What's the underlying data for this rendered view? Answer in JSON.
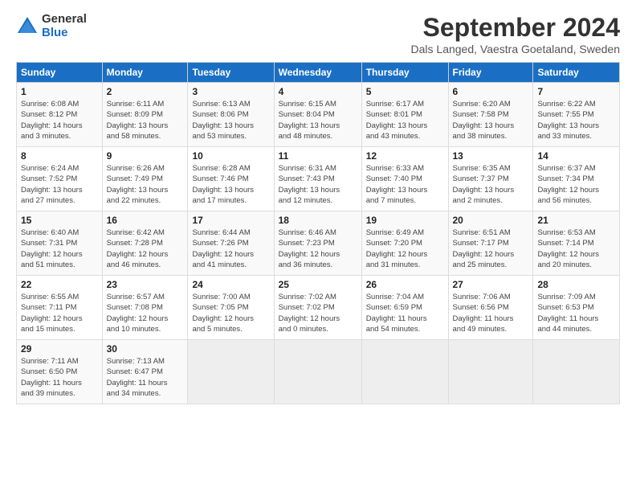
{
  "header": {
    "logo_general": "General",
    "logo_blue": "Blue",
    "month_title": "September 2024",
    "subtitle": "Dals Langed, Vaestra Goetaland, Sweden"
  },
  "days_of_week": [
    "Sunday",
    "Monday",
    "Tuesday",
    "Wednesday",
    "Thursday",
    "Friday",
    "Saturday"
  ],
  "weeks": [
    [
      {
        "day": "1",
        "info": "Sunrise: 6:08 AM\nSunset: 8:12 PM\nDaylight: 14 hours\nand 3 minutes."
      },
      {
        "day": "2",
        "info": "Sunrise: 6:11 AM\nSunset: 8:09 PM\nDaylight: 13 hours\nand 58 minutes."
      },
      {
        "day": "3",
        "info": "Sunrise: 6:13 AM\nSunset: 8:06 PM\nDaylight: 13 hours\nand 53 minutes."
      },
      {
        "day": "4",
        "info": "Sunrise: 6:15 AM\nSunset: 8:04 PM\nDaylight: 13 hours\nand 48 minutes."
      },
      {
        "day": "5",
        "info": "Sunrise: 6:17 AM\nSunset: 8:01 PM\nDaylight: 13 hours\nand 43 minutes."
      },
      {
        "day": "6",
        "info": "Sunrise: 6:20 AM\nSunset: 7:58 PM\nDaylight: 13 hours\nand 38 minutes."
      },
      {
        "day": "7",
        "info": "Sunrise: 6:22 AM\nSunset: 7:55 PM\nDaylight: 13 hours\nand 33 minutes."
      }
    ],
    [
      {
        "day": "8",
        "info": "Sunrise: 6:24 AM\nSunset: 7:52 PM\nDaylight: 13 hours\nand 27 minutes."
      },
      {
        "day": "9",
        "info": "Sunrise: 6:26 AM\nSunset: 7:49 PM\nDaylight: 13 hours\nand 22 minutes."
      },
      {
        "day": "10",
        "info": "Sunrise: 6:28 AM\nSunset: 7:46 PM\nDaylight: 13 hours\nand 17 minutes."
      },
      {
        "day": "11",
        "info": "Sunrise: 6:31 AM\nSunset: 7:43 PM\nDaylight: 13 hours\nand 12 minutes."
      },
      {
        "day": "12",
        "info": "Sunrise: 6:33 AM\nSunset: 7:40 PM\nDaylight: 13 hours\nand 7 minutes."
      },
      {
        "day": "13",
        "info": "Sunrise: 6:35 AM\nSunset: 7:37 PM\nDaylight: 13 hours\nand 2 minutes."
      },
      {
        "day": "14",
        "info": "Sunrise: 6:37 AM\nSunset: 7:34 PM\nDaylight: 12 hours\nand 56 minutes."
      }
    ],
    [
      {
        "day": "15",
        "info": "Sunrise: 6:40 AM\nSunset: 7:31 PM\nDaylight: 12 hours\nand 51 minutes."
      },
      {
        "day": "16",
        "info": "Sunrise: 6:42 AM\nSunset: 7:28 PM\nDaylight: 12 hours\nand 46 minutes."
      },
      {
        "day": "17",
        "info": "Sunrise: 6:44 AM\nSunset: 7:26 PM\nDaylight: 12 hours\nand 41 minutes."
      },
      {
        "day": "18",
        "info": "Sunrise: 6:46 AM\nSunset: 7:23 PM\nDaylight: 12 hours\nand 36 minutes."
      },
      {
        "day": "19",
        "info": "Sunrise: 6:49 AM\nSunset: 7:20 PM\nDaylight: 12 hours\nand 31 minutes."
      },
      {
        "day": "20",
        "info": "Sunrise: 6:51 AM\nSunset: 7:17 PM\nDaylight: 12 hours\nand 25 minutes."
      },
      {
        "day": "21",
        "info": "Sunrise: 6:53 AM\nSunset: 7:14 PM\nDaylight: 12 hours\nand 20 minutes."
      }
    ],
    [
      {
        "day": "22",
        "info": "Sunrise: 6:55 AM\nSunset: 7:11 PM\nDaylight: 12 hours\nand 15 minutes."
      },
      {
        "day": "23",
        "info": "Sunrise: 6:57 AM\nSunset: 7:08 PM\nDaylight: 12 hours\nand 10 minutes."
      },
      {
        "day": "24",
        "info": "Sunrise: 7:00 AM\nSunset: 7:05 PM\nDaylight: 12 hours\nand 5 minutes."
      },
      {
        "day": "25",
        "info": "Sunrise: 7:02 AM\nSunset: 7:02 PM\nDaylight: 12 hours\nand 0 minutes."
      },
      {
        "day": "26",
        "info": "Sunrise: 7:04 AM\nSunset: 6:59 PM\nDaylight: 11 hours\nand 54 minutes."
      },
      {
        "day": "27",
        "info": "Sunrise: 7:06 AM\nSunset: 6:56 PM\nDaylight: 11 hours\nand 49 minutes."
      },
      {
        "day": "28",
        "info": "Sunrise: 7:09 AM\nSunset: 6:53 PM\nDaylight: 11 hours\nand 44 minutes."
      }
    ],
    [
      {
        "day": "29",
        "info": "Sunrise: 7:11 AM\nSunset: 6:50 PM\nDaylight: 11 hours\nand 39 minutes."
      },
      {
        "day": "30",
        "info": "Sunrise: 7:13 AM\nSunset: 6:47 PM\nDaylight: 11 hours\nand 34 minutes."
      },
      {
        "day": "",
        "info": ""
      },
      {
        "day": "",
        "info": ""
      },
      {
        "day": "",
        "info": ""
      },
      {
        "day": "",
        "info": ""
      },
      {
        "day": "",
        "info": ""
      }
    ]
  ]
}
